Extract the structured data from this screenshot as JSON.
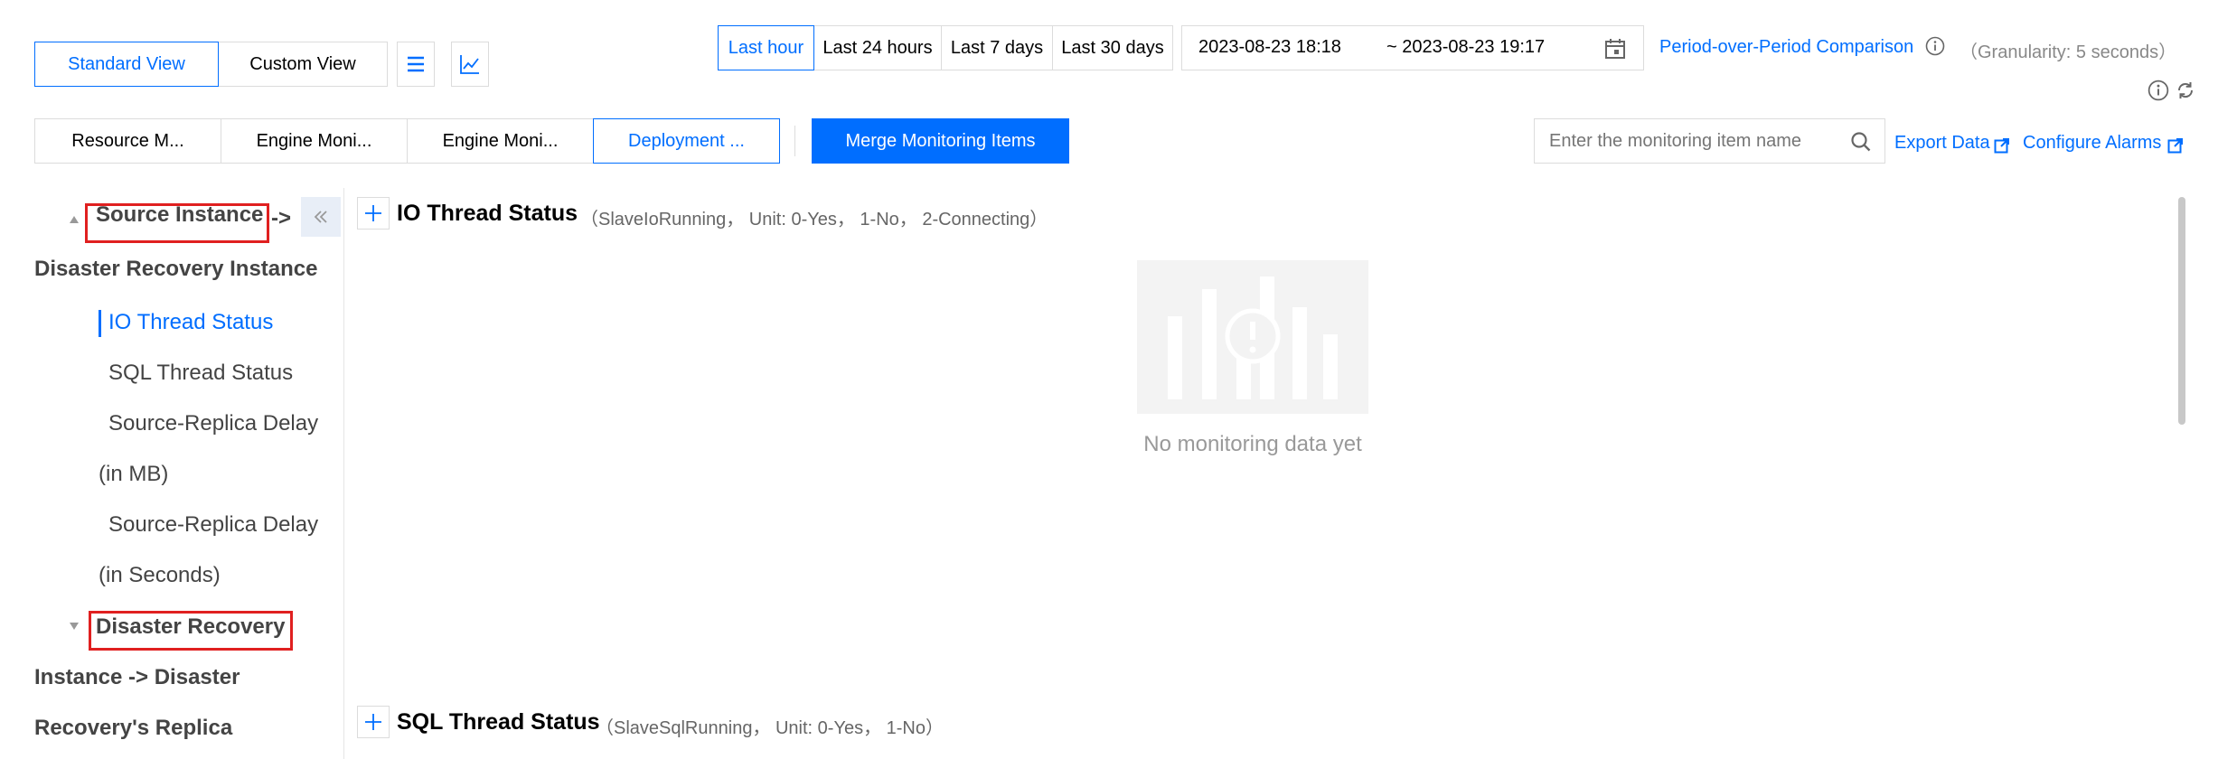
{
  "view_toggle": {
    "standard": "Standard View",
    "custom": "Custom View"
  },
  "time_range": {
    "options": [
      "Last hour",
      "Last 24 hours",
      "Last 7 days",
      "Last 30 days"
    ],
    "start": "2023-08-23 18:18",
    "end": "~ 2023-08-23 19:17"
  },
  "comparison": {
    "label": "Period-over-Period Comparison",
    "granularity": "（Granularity: 5 seconds）"
  },
  "category_tabs": [
    "Resource M...",
    "Engine Moni...",
    "Engine Moni...",
    "Deployment ..."
  ],
  "merge_button": "Merge Monitoring Items",
  "search": {
    "placeholder": "Enter the monitoring item name"
  },
  "actions": {
    "export": "Export Data",
    "alarms": "Configure Alarms"
  },
  "sidebar": {
    "group1": {
      "line1": "Source Instance",
      "arrow": "->",
      "line2": "Disaster Recovery Instance"
    },
    "items": {
      "io": "IO Thread Status",
      "sql": "SQL Thread Status",
      "delay_mb_1": "Source-Replica Delay",
      "delay_mb_2": "(in MB)",
      "delay_s_1": "Source-Replica Delay",
      "delay_s_2": "(in Seconds)"
    },
    "group2": {
      "line1": "Disaster Recovery",
      "line2": "Instance -> Disaster",
      "line3": "Recovery's Replica"
    }
  },
  "sections": [
    {
      "title": "IO Thread Status",
      "desc": "（SlaveIoRunning， Unit: 0-Yes， 1-No， 2-Connecting）",
      "empty_text": "No monitoring data yet"
    },
    {
      "title": "SQL Thread Status",
      "desc": "（SlaveSqlRunning， Unit: 0-Yes， 1-No）"
    }
  ],
  "colors": {
    "accent": "#006eff",
    "highlight_box": "#e02020"
  }
}
